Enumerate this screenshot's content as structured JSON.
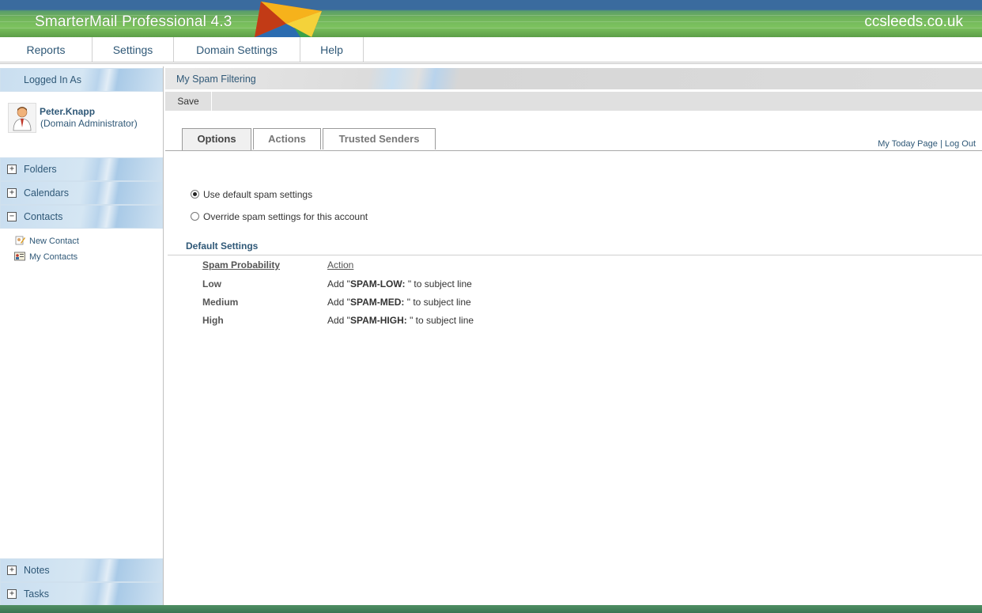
{
  "header": {
    "app_title": "SmarterMail Professional 4.3",
    "brand": "ccsleeds.co.uk",
    "colors": {
      "top_band": "#3a6b9e",
      "green_band": "#7cc25e",
      "link": "#2f5877"
    }
  },
  "nav": {
    "items": [
      {
        "label": "Reports"
      },
      {
        "label": "Settings"
      },
      {
        "label": "Domain Settings"
      },
      {
        "label": "Help"
      }
    ]
  },
  "sidebar": {
    "logged_in_header": "Logged In As",
    "user": {
      "name": "Peter.Knapp",
      "role": "(Domain Administrator)",
      "today_link": "My Today Page",
      "separator": "|",
      "logout_link": "Log Out",
      "avatar_icon": "user-avatar-icon"
    },
    "sections": [
      {
        "label": "Folders",
        "state": "+"
      },
      {
        "label": "Calendars",
        "state": "+"
      },
      {
        "label": "Contacts",
        "state": "−"
      },
      {
        "label": "Notes",
        "state": "+"
      },
      {
        "label": "Tasks",
        "state": "+"
      }
    ],
    "contacts_items": [
      {
        "label": "New Contact",
        "icon": "new-contact-icon"
      },
      {
        "label": "My Contacts",
        "icon": "contacts-card-icon"
      }
    ]
  },
  "main": {
    "page_title": "My Spam Filtering",
    "toolbar": {
      "save_label": "Save"
    },
    "tabs": [
      {
        "label": "Options",
        "active": true
      },
      {
        "label": "Actions",
        "active": false
      },
      {
        "label": "Trusted Senders",
        "active": false
      }
    ],
    "radios": [
      {
        "label": "Use default spam settings",
        "checked": true
      },
      {
        "label": "Override spam settings for this account",
        "checked": false
      }
    ],
    "default_settings": {
      "title": "Default Settings",
      "headers": {
        "probability": "Spam Probability",
        "action": "Action"
      },
      "rows": [
        {
          "probability": "Low",
          "action_prefix": "Add \"",
          "tag": "SPAM-LOW:",
          "action_suffix": " \" to subject line"
        },
        {
          "probability": "Medium",
          "action_prefix": "Add \"",
          "tag": "SPAM-MED:",
          "action_suffix": " \" to subject line"
        },
        {
          "probability": "High",
          "action_prefix": "Add \"",
          "tag": "SPAM-HIGH:",
          "action_suffix": " \" to subject line"
        }
      ]
    }
  }
}
